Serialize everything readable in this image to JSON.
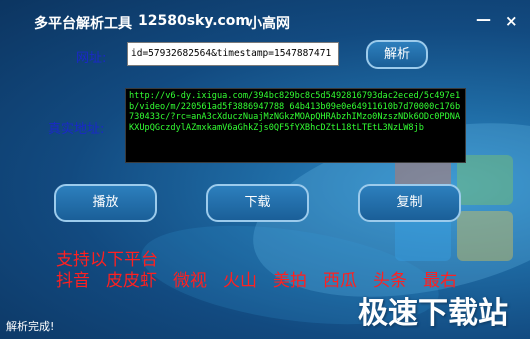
{
  "window": {
    "title": "多平台解析工具",
    "site": "12580sky.com",
    "author": "小高网",
    "minimize_label": "—",
    "close_label": "×"
  },
  "form": {
    "url_label": "网址:",
    "url_value": "id=57932682564&timestamp=1547887471",
    "parse_label": "解析",
    "real_label": "真实地址:",
    "real_address": "http://v6-dy.ixigua.com/394bc829bc8c5d5492816793dac2eced/5c497e1b/video/m/220561ad5f3886947788 64b413b09e0e64911610b7d70000c176b730433c/?rc=anA3cXduczNuajMzNGkzMOApQHRAbzhIMzo0NzszNDk6ODc0PDNAKXUpQGczdylAZmxkamV6aGhkZjs0QF5fYXBhcDZtL18tLTEtL3NzLW8jb"
  },
  "actions": {
    "play_label": "播放",
    "download_label": "下载",
    "copy_label": "复制"
  },
  "platforms": {
    "heading": "支持以下平台",
    "items": [
      "抖音",
      "皮皮虾",
      "微视",
      "火山",
      "美拍",
      "西瓜",
      "头条",
      "最右"
    ]
  },
  "status": "解析完成!",
  "watermark": "极速下载站"
}
